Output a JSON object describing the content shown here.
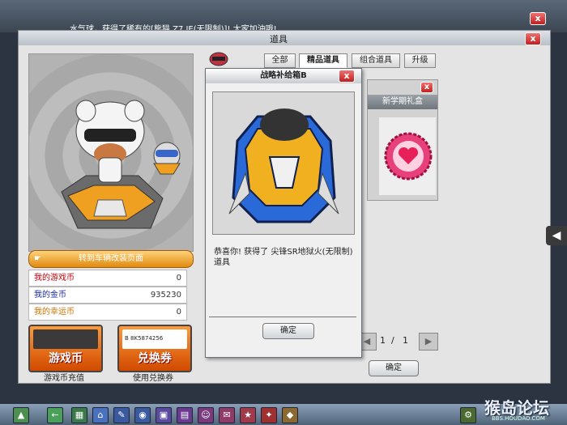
{
  "back_window": {
    "title": "",
    "close": "x"
  },
  "news_ticker": "水气球，获得了稀有的[熊猫 Z7 IE(无限制)]! 大家加油哦!",
  "main_window": {
    "title": "道具",
    "close": "x"
  },
  "tabs": [
    {
      "label": "全部",
      "active": false
    },
    {
      "label": "精品道具",
      "active": true
    },
    {
      "label": "组合道具",
      "active": false
    },
    {
      "label": "升级",
      "active": false
    }
  ],
  "left_panel": {
    "enter_label": "转到车辆改装页面",
    "stats": [
      {
        "label": "我的游戏币",
        "value": "0",
        "color": "#c0000a"
      },
      {
        "label": "我的金币",
        "value": "935230",
        "color": "#1a2aa0"
      },
      {
        "label": "我的幸运币",
        "value": "0",
        "color": "#d07000"
      }
    ],
    "buttons": [
      {
        "label": "游戏币",
        "caption": "游戏币充值"
      },
      {
        "label": "兑换券",
        "caption": "使用兑换券",
        "code": "B 8K5874256"
      }
    ]
  },
  "item_box": {
    "title": "新学期礼盒",
    "close": "x"
  },
  "pager": {
    "current": "1",
    "sep": "/",
    "total": "1",
    "prev": "◀",
    "next": "▶"
  },
  "main_ok": "确定",
  "dialog": {
    "title": "战略补给箱B",
    "close": "x",
    "message": "恭喜你! 获得了 尖锋SR地狱火(无限制)道具",
    "ok": "确定"
  },
  "side_handle": "◀",
  "watermark": {
    "text": "猴岛论坛",
    "sub": "BBS.HOUDAO.COM"
  },
  "colors": {
    "accent_orange": "#e08a10",
    "close_red": "#d03030"
  }
}
